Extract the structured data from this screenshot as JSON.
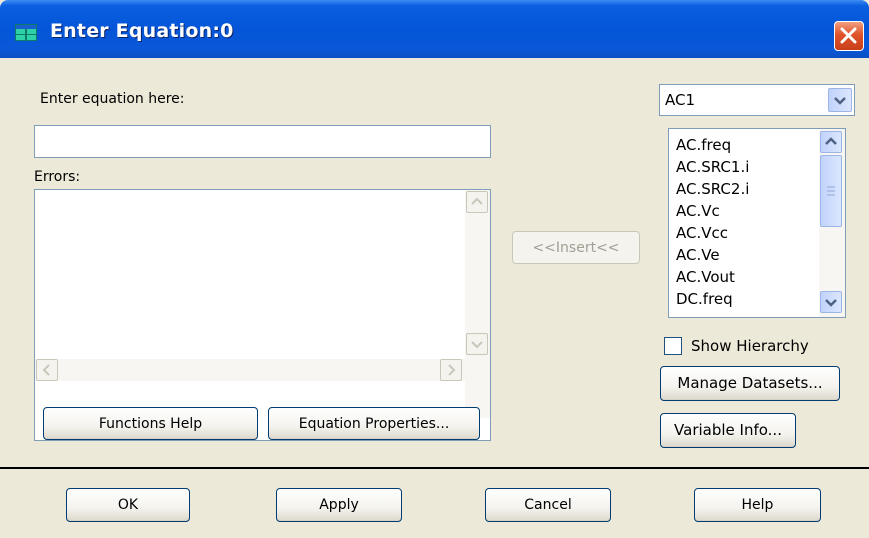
{
  "window": {
    "title": "Enter Equation:0"
  },
  "equation": {
    "label": "Enter equation here:",
    "value": ""
  },
  "errors": {
    "label": "Errors:",
    "text": ""
  },
  "insert_button": "<<Insert<<",
  "dataset_select": {
    "selected": "AC1"
  },
  "variables": [
    "AC.freq",
    "AC.SRC1.i",
    "AC.SRC2.i",
    "AC.Vc",
    "AC.Vcc",
    "AC.Ve",
    "AC.Vout",
    "DC.freq"
  ],
  "show_hierarchy": {
    "label": "Show Hierarchy",
    "checked": false
  },
  "buttons": {
    "functions_help": "Functions Help",
    "equation_properties": "Equation Properties...",
    "manage_datasets": "Manage Datasets...",
    "variable_info": "Variable Info...",
    "ok": "OK",
    "apply": "Apply",
    "cancel": "Cancel",
    "help": "Help"
  },
  "colors": {
    "titlebar": "#0555d8",
    "window_bg": "#ece9d8",
    "close_button": "#e0532b",
    "field_border": "#7f9db9"
  }
}
